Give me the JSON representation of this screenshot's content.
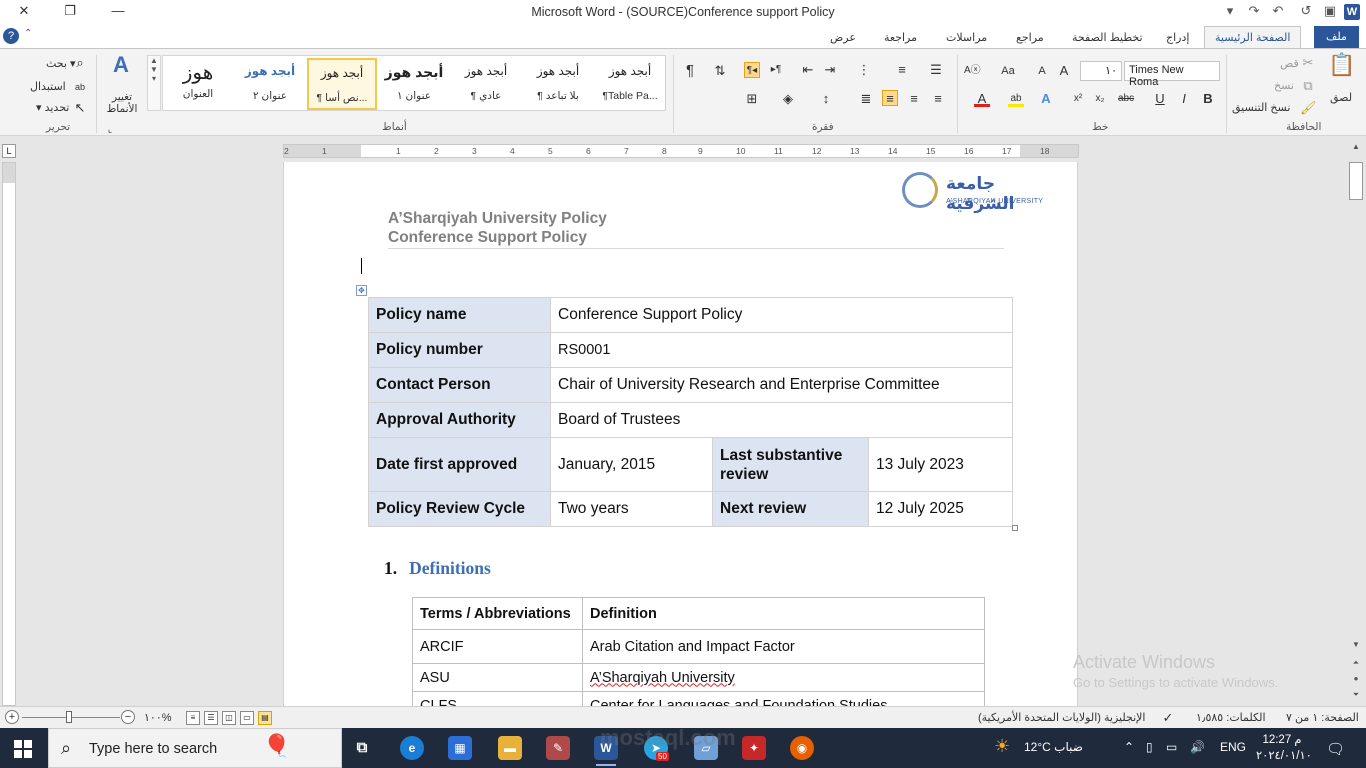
{
  "window": {
    "title": "Microsoft Word  -  (SOURCE)Conference support Policy",
    "minimize": "—",
    "restore": "❐",
    "close": "✕"
  },
  "tabs": {
    "file": "ملف",
    "home": "الصفحة الرئيسية",
    "insert": "إدراج",
    "layout": "تخطيط الصفحة",
    "references": "مراجع",
    "mailings": "مراسلات",
    "review": "مراجعة",
    "view": "عرض"
  },
  "ribbon": {
    "clipboard": {
      "label": "الحافظة",
      "paste": "لصق",
      "cut": "قص",
      "copy": "نسخ",
      "format_painter": "نسخ التنسيق"
    },
    "font": {
      "label": "خط",
      "name": "Times New Roma",
      "size": "١٠"
    },
    "paragraph": {
      "label": "فقرة"
    },
    "styles": {
      "label": "أنماط",
      "change": "تغيير الأنماط",
      "items": [
        {
          "preview": "أبجد هوز",
          "name": "¶Table Pa..."
        },
        {
          "preview": "أبجد هوز",
          "name": "¶ بلا تباعد"
        },
        {
          "preview": "أبجد هوز",
          "name": "¶ عادي"
        },
        {
          "preview": "أبجد هوز",
          "name": "عنوان ١"
        },
        {
          "preview": "أبجد هوز",
          "name": "¶ نص أسا..."
        },
        {
          "preview": "أبجد هوز",
          "name": "عنوان ٢"
        },
        {
          "preview": "هوز",
          "name": "العنوان"
        }
      ]
    },
    "editing": {
      "label": "تحرير",
      "find": "بحث",
      "replace": "استبدال",
      "select": "تحديد"
    }
  },
  "ruler": {
    "numbers": [
      "2",
      "1",
      "1",
      "2",
      "3",
      "4",
      "5",
      "6",
      "7",
      "8",
      "9",
      "10",
      "11",
      "12",
      "13",
      "14",
      "15",
      "16",
      "17",
      "18"
    ]
  },
  "document": {
    "logo": {
      "arabic": "جامعة الشرقية",
      "english": "A'SHARQIYAH UNIVERSITY"
    },
    "header_line1": "A’Sharqiyah University Policy",
    "header_line2": "Conference Support Policy",
    "policy_table": {
      "policy_name_label": "Policy name",
      "policy_name": "Conference Support Policy",
      "policy_number_label": "Policy number",
      "policy_number": "RS0001",
      "contact_label": "Contact Person",
      "contact": "Chair of University Research and Enterprise Committee",
      "approval_label": "Approval Authority",
      "approval": "Board of Trustees",
      "date_first_label": "Date first approved",
      "date_first": "January, 2015",
      "last_review_label": "Last substantive review",
      "last_review": "13 July 2023",
      "review_cycle_label": "Policy Review Cycle",
      "review_cycle": "Two years",
      "next_review_label": "Next review",
      "next_review": "12 July 2025"
    },
    "section_number": "1.",
    "section_title": "Definitions",
    "definitions": {
      "header_terms": "Terms / Abbreviations",
      "header_definition": "Definition",
      "rows": [
        {
          "term": "ARCIF",
          "definition": "Arab Citation and Impact Factor"
        },
        {
          "term": "ASU",
          "definition": "A’Sharqiyah University"
        },
        {
          "term": "CLFS",
          "definition": "Center for Languages and Foundation Studies"
        }
      ]
    }
  },
  "activate": {
    "line1": "Activate Windows",
    "line2": "Go to Settings to activate Windows."
  },
  "watermark": "mostaql.com",
  "statusbar": {
    "page": "الصفحة: ١ من ٧",
    "words": "الكلمات: ١٫٥٨٥",
    "language": "الإنجليزية (الولايات المتحدة الأمريكية)",
    "zoom": "١٠٠%"
  },
  "taskbar": {
    "search_placeholder": "Type here to search",
    "weather": "12°C  ضباب",
    "lang": "ENG",
    "time": "12:27 م",
    "date": "٢٠٢٤/٠١/١٠",
    "badge": "50"
  }
}
